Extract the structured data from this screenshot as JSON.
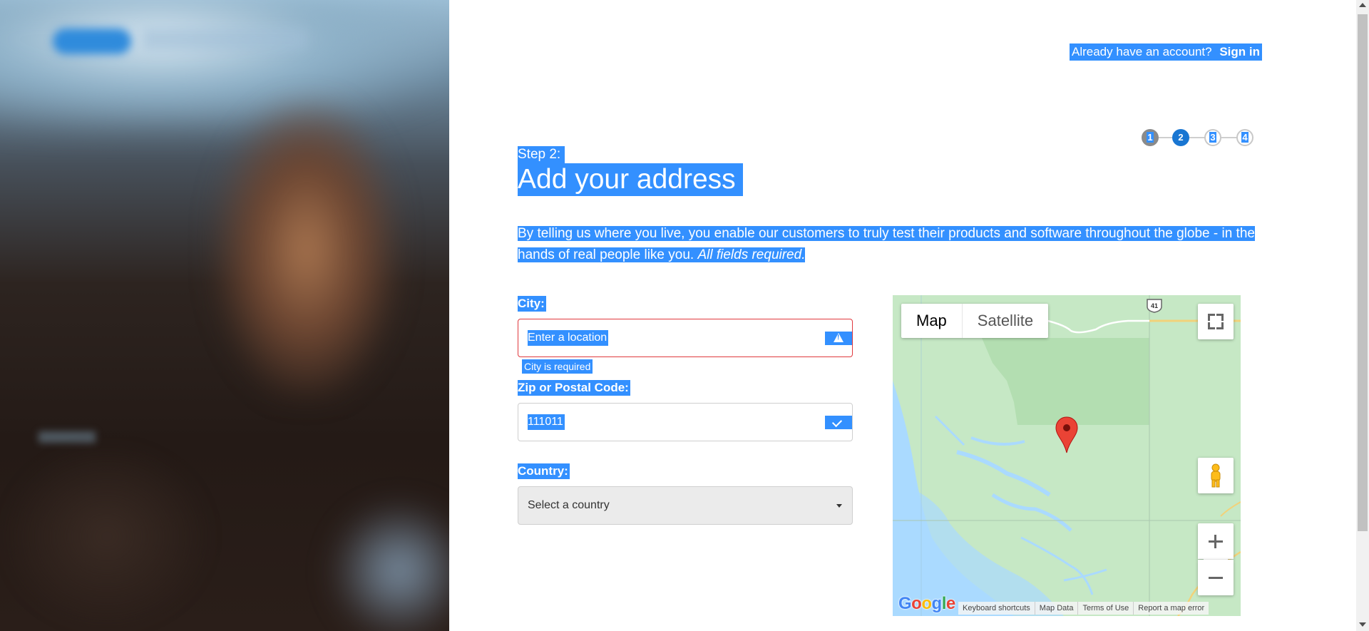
{
  "signin": {
    "prompt": "Already have an account?",
    "link": "Sign in"
  },
  "stepper": {
    "steps": [
      "1",
      "2",
      "3",
      "4"
    ],
    "current": 2
  },
  "heading": {
    "step_label": "Step 2:",
    "title": "Add your address"
  },
  "intro": {
    "text": "By telling us where you live, you enable our customers to truly test their products and software throughout the globe - in the hands of real people like you.",
    "emphasis": "All fields required."
  },
  "form": {
    "city": {
      "label": "City:",
      "placeholder": "Enter a location",
      "error": "City is required"
    },
    "zip": {
      "label": "Zip or Postal Code:",
      "value": "111011"
    },
    "country": {
      "label": "Country:",
      "selected": "Select a country"
    }
  },
  "map": {
    "type_buttons": [
      "Map",
      "Satellite"
    ],
    "active_type": "Map",
    "route_shield": "41",
    "logo": "Google",
    "footer": [
      "Keyboard shortcuts",
      "Map Data",
      "Terms of Use",
      "Report a map error"
    ]
  },
  "colors": {
    "selection": "#3390ff",
    "step_active": "#1976d2",
    "error_border": "#e0393e",
    "map_land": "#c6e8c5",
    "map_water": "#aadaff",
    "pin": "#ea4335"
  }
}
